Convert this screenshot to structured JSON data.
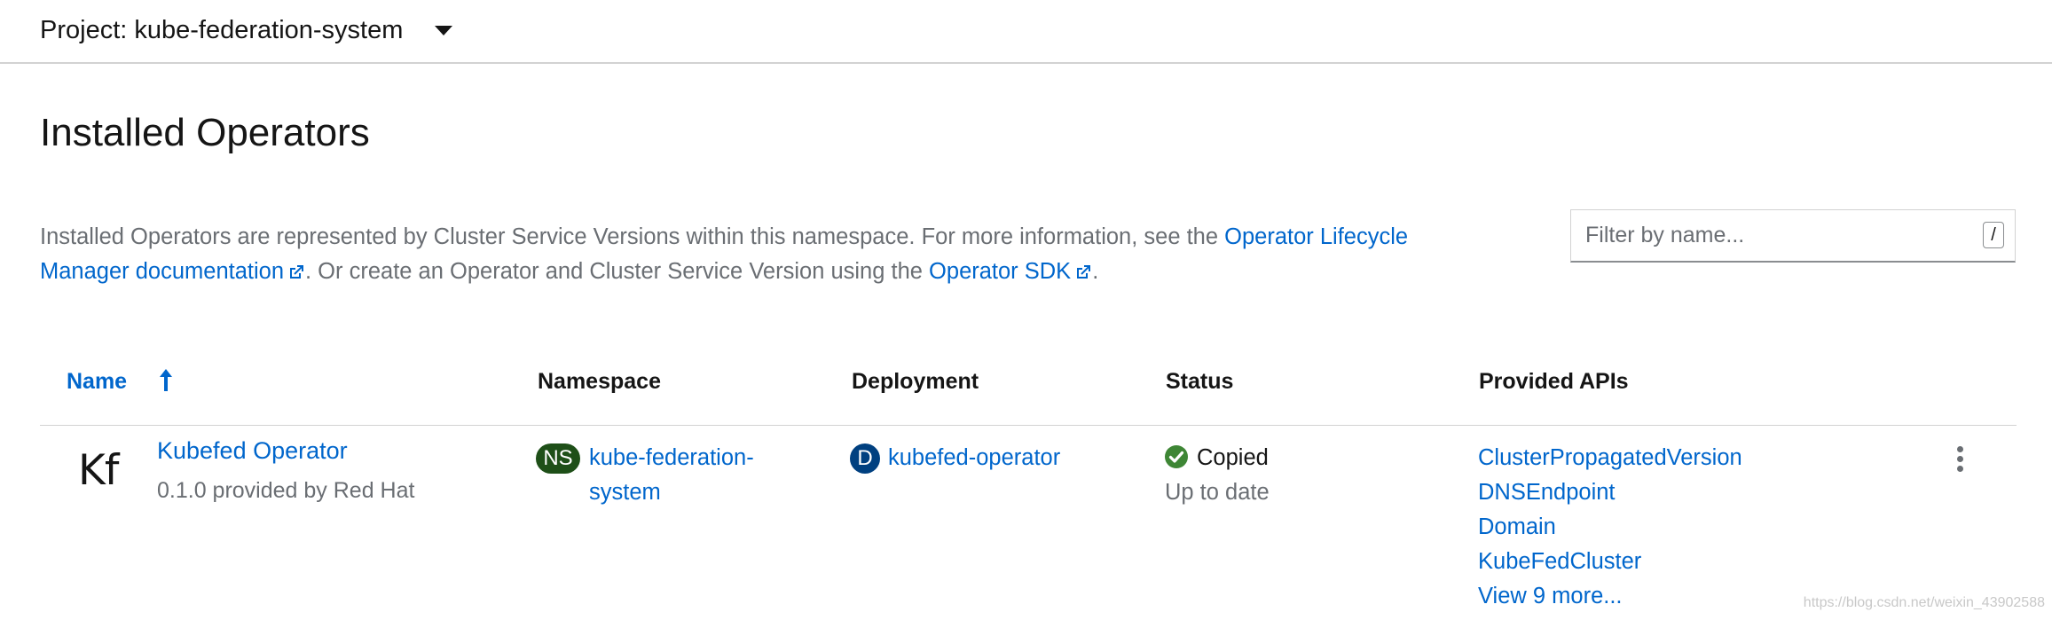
{
  "project": {
    "label": "Project: kube-federation-system"
  },
  "page": {
    "title": "Installed Operators"
  },
  "description": {
    "text1": "Installed Operators are represented by Cluster Service Versions within this namespace. For more information, see the ",
    "olm_link": "Operator Lifecycle Manager documentation",
    "text2": ". Or create an Operator and Cluster Service Version using the ",
    "sdk_link": "Operator SDK",
    "text3": "."
  },
  "filter": {
    "placeholder": "Filter by name...",
    "shortcut": "/"
  },
  "table": {
    "columns": {
      "name": "Name",
      "namespace": "Namespace",
      "deployment": "Deployment",
      "status": "Status",
      "apis": "Provided APIs"
    },
    "sort_direction": "ascending",
    "rows": [
      {
        "logo": "Kf",
        "name": "Kubefed Operator",
        "provider": "0.1.0 provided by Red Hat",
        "namespace_badge": "NS",
        "namespace": "kube-federation-system",
        "deployment_badge": "D",
        "deployment": "kubefed-operator",
        "status": "Copied",
        "status_sub": "Up to date",
        "apis": [
          "ClusterPropagatedVersion",
          "DNSEndpoint",
          "Domain",
          "KubeFedCluster"
        ],
        "more": "View 9 more..."
      }
    ]
  },
  "watermark": "https://blog.csdn.net/weixin_43902588",
  "colors": {
    "link": "#0066cc",
    "ns_badge": "#1e4f18",
    "deployment_badge": "#004080",
    "status_ok": "#3e8635"
  }
}
